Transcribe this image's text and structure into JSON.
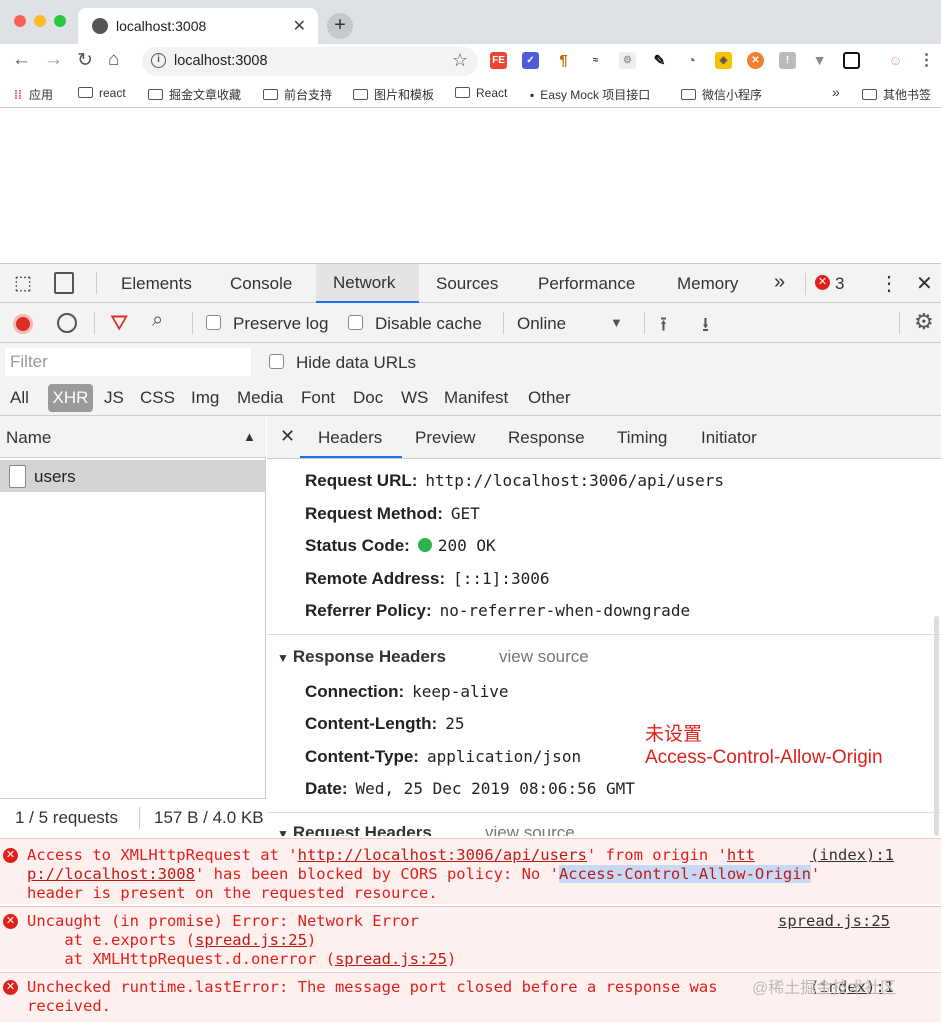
{
  "browser": {
    "tab_title": "localhost:3008",
    "url": "localhost:3008",
    "bookmarks": [
      "应用",
      "react",
      "掘金文章收藏",
      "前台支持",
      "图片和模板",
      "React",
      "Easy Mock 项目接口",
      "微信小程序",
      "»",
      "其他书签"
    ]
  },
  "devtools": {
    "tabs": [
      "Elements",
      "Console",
      "Network",
      "Sources",
      "Performance",
      "Memory",
      "»"
    ],
    "error_count": "3",
    "preserve_log": "Preserve log",
    "disable_cache": "Disable cache",
    "throttle": "Online",
    "filter_placeholder": "Filter",
    "hide_data_urls": "Hide data URLs",
    "filter_types": [
      "All",
      "XHR",
      "JS",
      "CSS",
      "Img",
      "Media",
      "Font",
      "Doc",
      "WS",
      "Manifest",
      "Other"
    ],
    "name_header": "Name",
    "request_name": "users",
    "footer_requests": "1 / 5 requests",
    "footer_size": "157 B / 4.0 KB",
    "subtabs": [
      "Headers",
      "Preview",
      "Response",
      "Timing",
      "Initiator"
    ],
    "general": {
      "request_url_label": "Request URL:",
      "request_url": "http://localhost:3006/api/users",
      "method_label": "Request Method:",
      "method": "GET",
      "status_label": "Status Code:",
      "status": "200 OK",
      "remote_label": "Remote Address:",
      "remote": "[::1]:3006",
      "referrer_label": "Referrer Policy:",
      "referrer": "no-referrer-when-downgrade"
    },
    "response_headers": {
      "title": "Response Headers",
      "view_source": "view source",
      "connection_label": "Connection:",
      "connection": "keep-alive",
      "length_label": "Content-Length:",
      "length": "25",
      "type_label": "Content-Type:",
      "type": "application/json",
      "date_label": "Date:",
      "date": "Wed, 25 Dec 2019 08:06:56 GMT"
    },
    "request_headers_title": "Request Headers",
    "annotation": [
      "未设置",
      "Access-Control-Allow-Origin"
    ]
  },
  "console": {
    "error1": {
      "pre": "Access to XMLHttpRequest at '",
      "url": "http://localhost:3006/api/users",
      "mid": "' from origin '",
      "origin_a": "htt",
      "src": "(index):1",
      "origin_b": "p://localhost:3008",
      "mid2": "' has been blocked by CORS policy: No '",
      "header": "Access-Control-Allow-Origin",
      "end": "'",
      "line3": "header is present on the requested resource."
    },
    "error2": {
      "line1": "Uncaught (in promise) Error: Network Error",
      "src": "spread.js:25",
      "line2a": "    at e.exports (",
      "line2b": "spread.js:25",
      "line2c": ")",
      "line3a": "    at XMLHttpRequest.d.onerror (",
      "line3b": "spread.js:25",
      "line3c": ")"
    },
    "error3": {
      "line1": "Unchecked runtime.lastError: The message port closed before a response was",
      "src": "(index):1",
      "line2": "received."
    }
  },
  "watermark": "@稀土掘金技术社区"
}
